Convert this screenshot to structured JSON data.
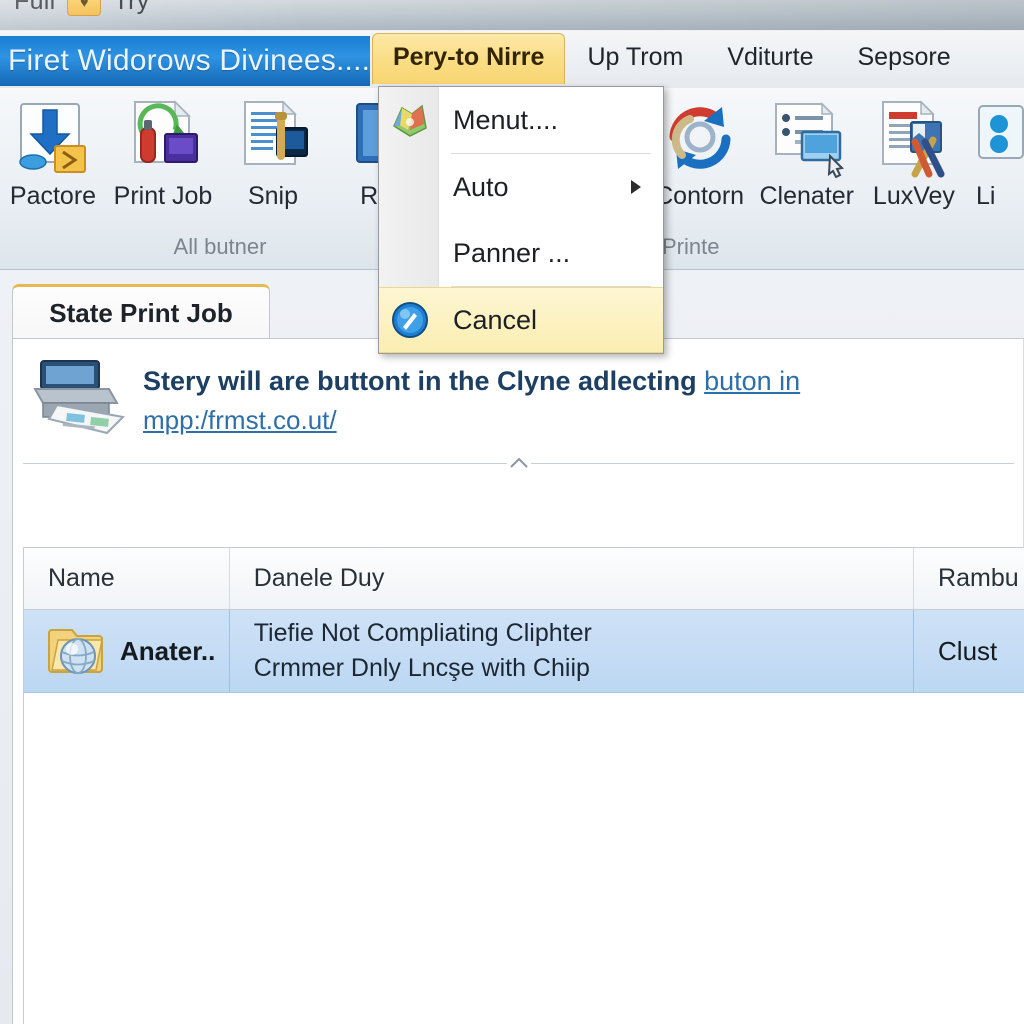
{
  "topstrip": {
    "left_label": "Full",
    "badge_glyph": "♥",
    "right_label": "Try"
  },
  "addressbar": {
    "text": "Firet Widorows Divinees........"
  },
  "ribbon": {
    "tabs": [
      {
        "label": "Pery-to Nirre",
        "active": true
      },
      {
        "label": "Up Trom",
        "active": false
      },
      {
        "label": "Vditurte",
        "active": false
      },
      {
        "label": "Sepsore",
        "active": false
      }
    ],
    "groups": [
      {
        "label": "All butner",
        "items": [
          {
            "label": "Pactore",
            "icon": "download-arrow-icon"
          },
          {
            "label": "Print Job",
            "icon": "print-job-icon"
          },
          {
            "label": "Snip",
            "icon": "snip-icon"
          },
          {
            "label": "Rep",
            "icon": "report-icon"
          }
        ]
      },
      {
        "label": "Printe",
        "items": [
          {
            "label": "Contorn",
            "icon": "refresh-sync-icon"
          },
          {
            "label": "Clenater",
            "icon": "list-window-icon"
          },
          {
            "label": "LuxVey",
            "icon": "document-tools-icon"
          },
          {
            "label": "Li",
            "icon": "partial-blue-icon"
          }
        ]
      }
    ]
  },
  "menu": {
    "items": [
      {
        "label": "Menut....",
        "icon": "colorful-app-icon",
        "has_submenu": false,
        "highlight": false
      },
      {
        "label": "Auto",
        "icon": "",
        "has_submenu": true,
        "highlight": false
      },
      {
        "label": "Panner ...",
        "icon": "",
        "has_submenu": false,
        "highlight": false
      },
      {
        "label": "Cancel",
        "icon": "compass-icon",
        "has_submenu": false,
        "highlight": true
      }
    ]
  },
  "content": {
    "doc_tab_label": "State Print Job",
    "notice": {
      "icon": "printer-icon",
      "line1_text": "Stery will are buttont in the Clyne adlecting ",
      "line1_link": "buton in",
      "line2_link": "mpp:/frmst.co.ut/"
    },
    "table": {
      "columns": [
        "Name",
        "Danele Duy",
        "Rambu"
      ],
      "rows": [
        {
          "icon": "folder-globe-icon",
          "name": "Anater..",
          "detail_line1": "Tiefie Not Compliating Cliphter",
          "detail_line2": "Crmmer Dnly Lncşe with Chiip",
          "status": "Clust",
          "selected": true
        }
      ]
    }
  },
  "colors": {
    "accent_blue": "#1a7fd4",
    "tab_active_yellow": "#fadd83",
    "menu_highlight": "#fbeeb2",
    "row_selected": "#bcd7f2",
    "link": "#2f6fa8",
    "heading": "#1c3f63"
  }
}
